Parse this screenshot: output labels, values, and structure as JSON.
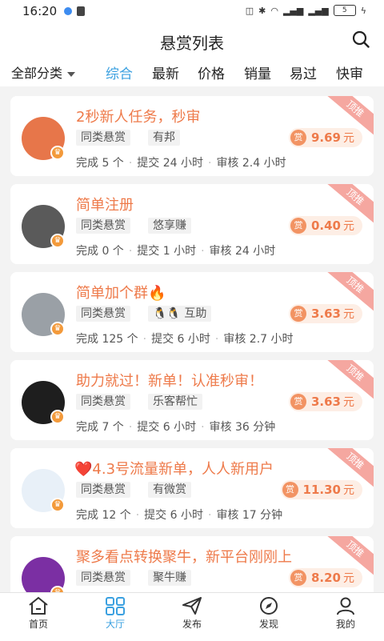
{
  "status": {
    "time": "16:20",
    "battery": "5"
  },
  "header": {
    "title": "悬赏列表"
  },
  "filter": {
    "category": "全部分类",
    "tabs": [
      "综合",
      "最新",
      "价格",
      "销量",
      "易过",
      "快审"
    ]
  },
  "ribbon_label": "顶推",
  "reward_badge": "赏",
  "currency_unit": "元",
  "tasks": [
    {
      "title": "2秒新人任务，秒审",
      "tags": [
        "同类悬赏",
        "有邦"
      ],
      "reward": "9.69",
      "done": "完成 5 个",
      "submit": "提交 24 小时",
      "review": "审核 2.4 小时",
      "avatar_color": "#e7764a"
    },
    {
      "title": "简单注册",
      "tags": [
        "同类悬赏",
        "悠享赚"
      ],
      "reward": "0.40",
      "done": "完成 0 个",
      "submit": "提交 1 小时",
      "review": "审核 24 小时",
      "avatar_color": "#5a5a5a"
    },
    {
      "title": "简单加个群🔥",
      "tags": [
        "同类悬赏",
        "🐧🐧 互助"
      ],
      "reward": "3.63",
      "done": "完成 125 个",
      "submit": "提交 6 小时",
      "review": "审核 2.7 小时",
      "avatar_color": "#9aa0a6"
    },
    {
      "title": "助力就过！新单！认准秒审！",
      "tags": [
        "同类悬赏",
        "乐客帮忙"
      ],
      "reward": "3.63",
      "done": "完成 7 个",
      "submit": "提交 6 小时",
      "review": "审核 36 分钟",
      "avatar_color": "#1e1e1e"
    },
    {
      "title": "❤️4.3号流量新单，人人新用户",
      "tags": [
        "同类悬赏",
        "有微赏"
      ],
      "reward": "11.30",
      "done": "完成 12 个",
      "submit": "提交 6 小时",
      "review": "审核 17 分钟",
      "avatar_color": "#e8f0f8"
    },
    {
      "title": "聚多看点转换聚牛，新平台刚刚上",
      "tags": [
        "同类悬赏",
        "聚牛赚"
      ],
      "reward": "8.20",
      "done": "",
      "submit": "",
      "review": "",
      "avatar_color": "#7b2fa3"
    }
  ],
  "nav": [
    {
      "label": "首页",
      "icon": "home-icon"
    },
    {
      "label": "大厅",
      "icon": "hall-icon"
    },
    {
      "label": "发布",
      "icon": "send-icon"
    },
    {
      "label": "发现",
      "icon": "compass-icon"
    },
    {
      "label": "我的",
      "icon": "user-icon"
    }
  ],
  "colors": {
    "accent": "#3aa0e0",
    "reward": "#ee7a4a",
    "ribbon": "#f5a7a0"
  }
}
